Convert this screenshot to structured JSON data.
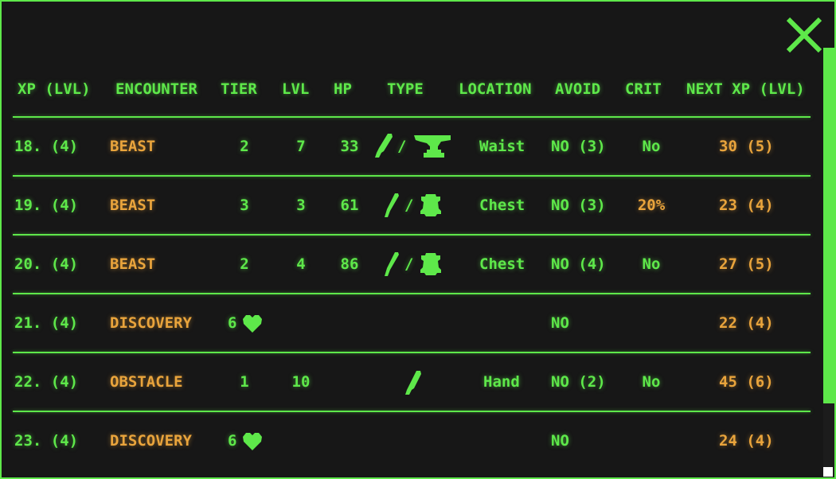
{
  "headers": {
    "xp": "XP (LVL)",
    "encounter": "ENCOUNTER",
    "tier": "TIER",
    "lvl": "LVL",
    "hp": "HP",
    "type": "TYPE",
    "location": "LOCATION",
    "avoid": "AVOID",
    "crit": "CRIT",
    "next_xp": "NEXT XP (LVL)"
  },
  "colors": {
    "green": "#5ee84a",
    "orange": "#e9a43c",
    "background": "#171717"
  },
  "rows": [
    {
      "xp": "18. (4)",
      "encounter": "BEAST",
      "tier": "2",
      "lvl": "7",
      "hp": "33",
      "type_icons": [
        "blade-icon",
        "anvil-icon"
      ],
      "type_sep": "/",
      "location": "Waist",
      "avoid": "NO (3)",
      "crit": "No",
      "next_xp": "30 (5)"
    },
    {
      "xp": "19. (4)",
      "encounter": "BEAST",
      "tier": "3",
      "lvl": "3",
      "hp": "61",
      "type_icons": [
        "blade-icon",
        "hide-icon"
      ],
      "type_sep": "/",
      "location": "Chest",
      "avoid": "NO (3)",
      "crit": "20%",
      "next_xp": "23 (4)"
    },
    {
      "xp": "20. (4)",
      "encounter": "BEAST",
      "tier": "2",
      "lvl": "4",
      "hp": "86",
      "type_icons": [
        "blade-icon",
        "hide-icon"
      ],
      "type_sep": "/",
      "location": "Chest",
      "avoid": "NO (4)",
      "crit": "No",
      "next_xp": "27 (5)"
    },
    {
      "xp": "21. (4)",
      "encounter": "DISCOVERY",
      "tier": "6",
      "tier_icon": "heart-icon",
      "lvl": "",
      "hp": "",
      "location": "",
      "avoid": "NO",
      "crit": "",
      "next_xp": "22 (4)"
    },
    {
      "xp": "22. (4)",
      "encounter": "OBSTACLE",
      "tier": "1",
      "lvl": "10",
      "hp": "",
      "type_icons": [
        "blade-icon"
      ],
      "location": "Hand",
      "avoid": "NO (2)",
      "crit": "No",
      "next_xp": "45 (6)"
    },
    {
      "xp": "23. (4)",
      "encounter": "DISCOVERY",
      "tier": "6",
      "tier_icon": "heart-icon",
      "lvl": "",
      "hp": "",
      "location": "",
      "avoid": "NO",
      "crit": "",
      "next_xp": "24 (4)"
    }
  ]
}
